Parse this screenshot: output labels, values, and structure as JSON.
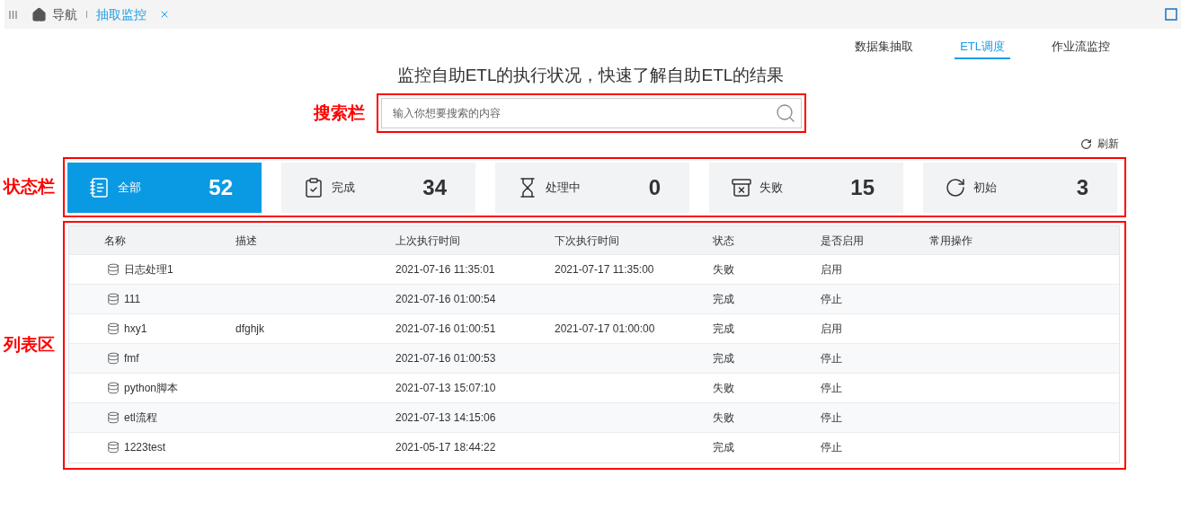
{
  "tabbar": {
    "tabs": [
      {
        "label": "导航",
        "kind": "home",
        "selected": false
      },
      {
        "label": "抽取监控",
        "kind": "page",
        "selected": true
      }
    ]
  },
  "subnav": [
    {
      "label": "数据集抽取",
      "selected": false
    },
    {
      "label": "ETL调度",
      "selected": true
    },
    {
      "label": "作业流监控",
      "selected": false
    }
  ],
  "title": "监控自助ETL的执行状况，快速了解自助ETL的结果",
  "annotations": {
    "search": "搜索栏",
    "status": "状态栏",
    "list": "列表区"
  },
  "search": {
    "placeholder": "输入你想要搜索的内容"
  },
  "refresh": "刷新",
  "status_cards": [
    {
      "kind": "all",
      "label": "全部",
      "count": "52",
      "selected": true
    },
    {
      "kind": "done",
      "label": "完成",
      "count": "34",
      "selected": false
    },
    {
      "kind": "processing",
      "label": "处理中",
      "count": "0",
      "selected": false
    },
    {
      "kind": "failed",
      "label": "失败",
      "count": "15",
      "selected": false
    },
    {
      "kind": "initial",
      "label": "初始",
      "count": "3",
      "selected": false
    }
  ],
  "table": {
    "columns": [
      "名称",
      "描述",
      "上次执行时间",
      "下次执行时间",
      "状态",
      "是否启用",
      "常用操作"
    ],
    "rows": [
      {
        "name": "日志处理1",
        "last_run": "2021-07-16 11:35:01",
        "next_run": "2021-07-17 11:35:00",
        "status": "失败",
        "enabled": "启用"
      },
      {
        "name": "111",
        "last_run": "2021-07-16 01:00:54",
        "status": "完成",
        "enabled": "停止"
      },
      {
        "name": "hxy1",
        "description": "dfghjk",
        "last_run": "2021-07-16 01:00:51",
        "next_run": "2021-07-17 01:00:00",
        "status": "完成",
        "enabled": "启用"
      },
      {
        "name": "fmf",
        "last_run": "2021-07-16 01:00:53",
        "status": "完成",
        "enabled": "停止"
      },
      {
        "name": "python脚本",
        "last_run": "2021-07-13 15:07:10",
        "status": "失败",
        "enabled": "停止"
      },
      {
        "name": "etl流程",
        "last_run": "2021-07-13 14:15:06",
        "status": "失败",
        "enabled": "停止"
      },
      {
        "name": "1223test",
        "last_run": "2021-05-17 18:44:22",
        "status": "完成",
        "enabled": "停止"
      }
    ]
  }
}
